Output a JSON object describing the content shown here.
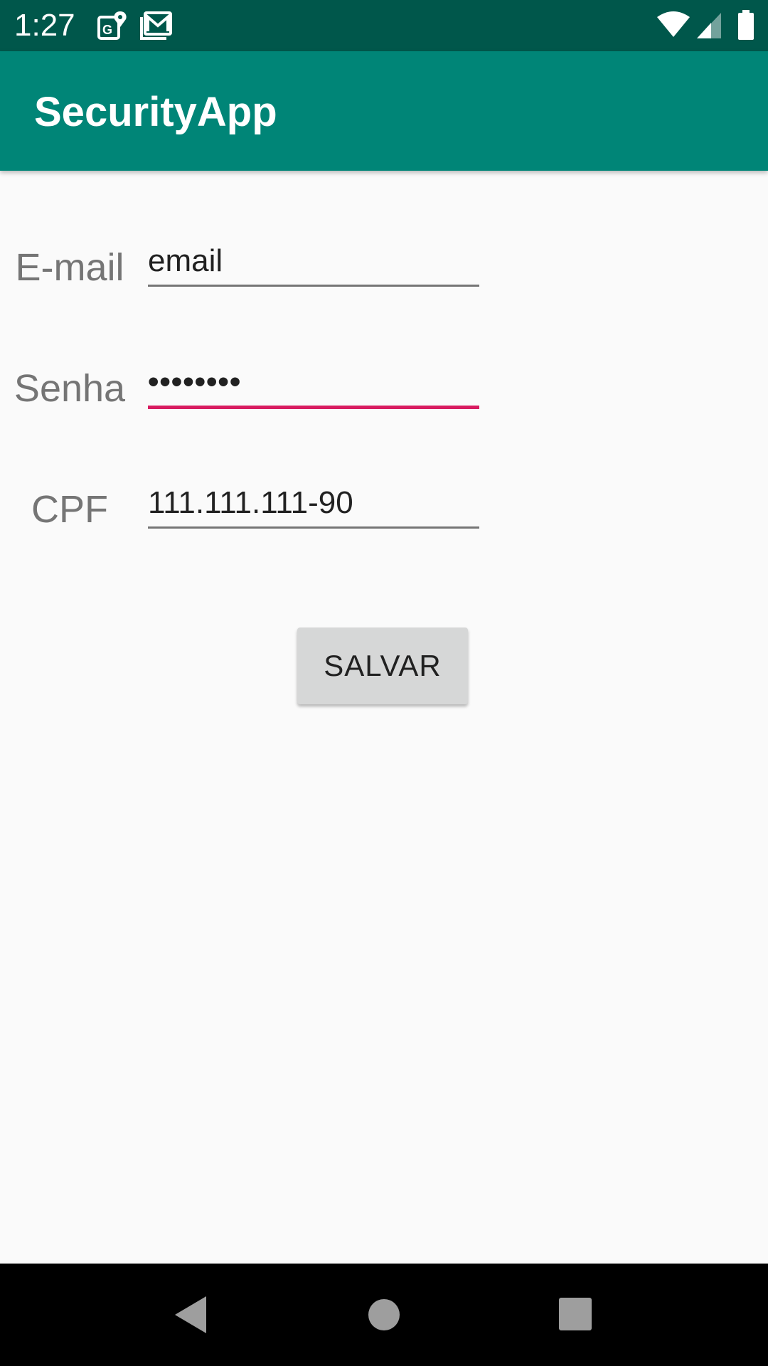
{
  "status_bar": {
    "time": "1:27",
    "left_icons": [
      "maps-notification-icon",
      "gmail-notification-icon"
    ],
    "right_icons": [
      "wifi-icon",
      "cell-signal-icon",
      "battery-icon"
    ]
  },
  "app_bar": {
    "title": "SecurityApp"
  },
  "form": {
    "email": {
      "label": "E-mail",
      "value": "email"
    },
    "password": {
      "label": "Senha",
      "value": "••••••••",
      "focused": true
    },
    "cpf": {
      "label": "CPF",
      "value": "111.111.111-90"
    },
    "save_label": "SALVAR"
  },
  "nav_bar": {
    "icons": [
      "back-icon",
      "home-icon",
      "recents-icon"
    ]
  },
  "colors": {
    "status_bar": "#00574b",
    "app_bar": "#008577",
    "accent": "#d81b60",
    "background": "#fafafa",
    "button": "#d6d7d7"
  }
}
